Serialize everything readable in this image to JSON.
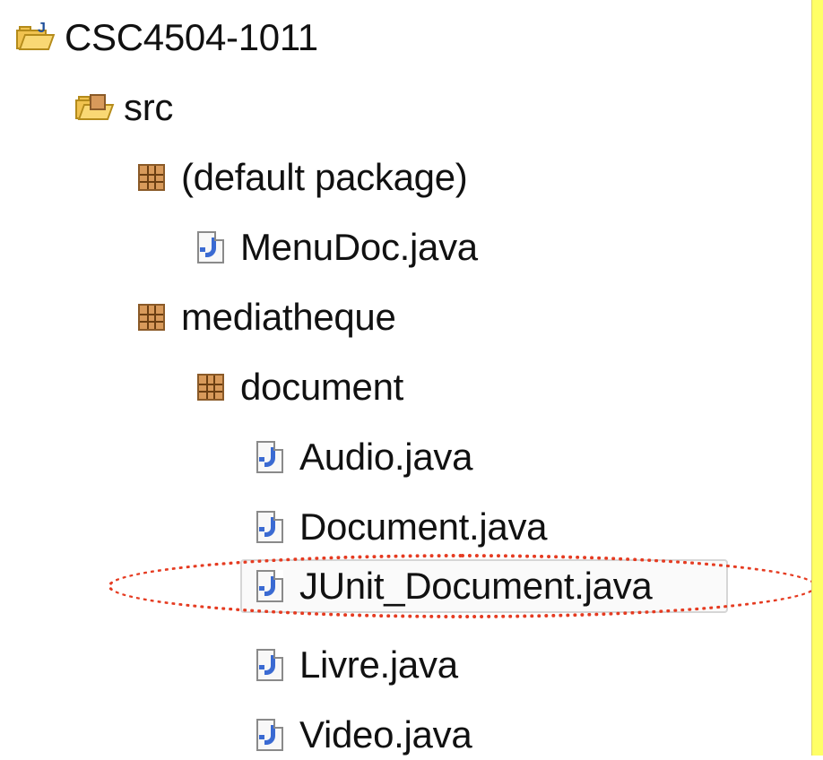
{
  "project_explorer": {
    "project": {
      "label": "CSC4504-1011",
      "icon": "java-project-folder-icon"
    },
    "src": {
      "label": "src",
      "icon": "source-folder-icon"
    },
    "default_package": {
      "label": "(default package)",
      "icon": "package-icon",
      "files": [
        {
          "label": "MenuDoc.java",
          "icon": "java-file-icon"
        }
      ]
    },
    "mediatheque": {
      "label": "mediatheque",
      "icon": "package-icon"
    },
    "document": {
      "label": "document",
      "icon": "package-icon",
      "files": [
        {
          "label": "Audio.java",
          "icon": "java-file-icon"
        },
        {
          "label": "Document.java",
          "icon": "java-file-icon"
        },
        {
          "label": "JUnit_Document.java",
          "icon": "java-file-icon"
        },
        {
          "label": "Livre.java",
          "icon": "java-file-icon"
        },
        {
          "label": "Video.java",
          "icon": "java-file-icon"
        }
      ]
    }
  },
  "highlight": {
    "color": "#e53b21",
    "selected_item": "JUnit_Document.java"
  },
  "colors": {
    "right_strip": "#ffff66"
  }
}
